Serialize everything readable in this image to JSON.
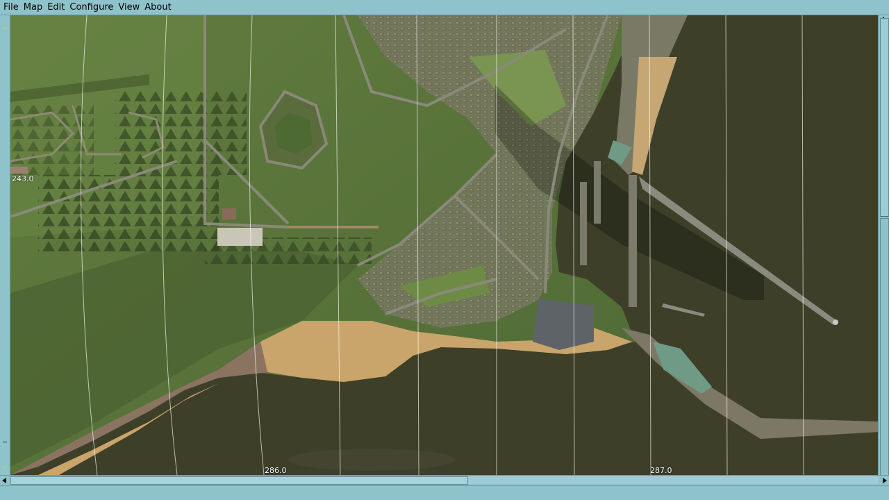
{
  "menu": {
    "items": [
      {
        "label": "File"
      },
      {
        "label": "Map"
      },
      {
        "label": "Edit"
      },
      {
        "label": "Configure"
      },
      {
        "label": "View"
      },
      {
        "label": "About"
      }
    ]
  },
  "map": {
    "y_grid_label": "243.0",
    "x_grid_labels": [
      "286.0",
      "287.0"
    ],
    "colors": {
      "water": "#3d3f29",
      "land_green": "#5d7a3c",
      "forest": "#4b6532",
      "beach": "#c9a46b",
      "town": "#7d8069"
    }
  },
  "statusbar": {
    "text": ""
  }
}
